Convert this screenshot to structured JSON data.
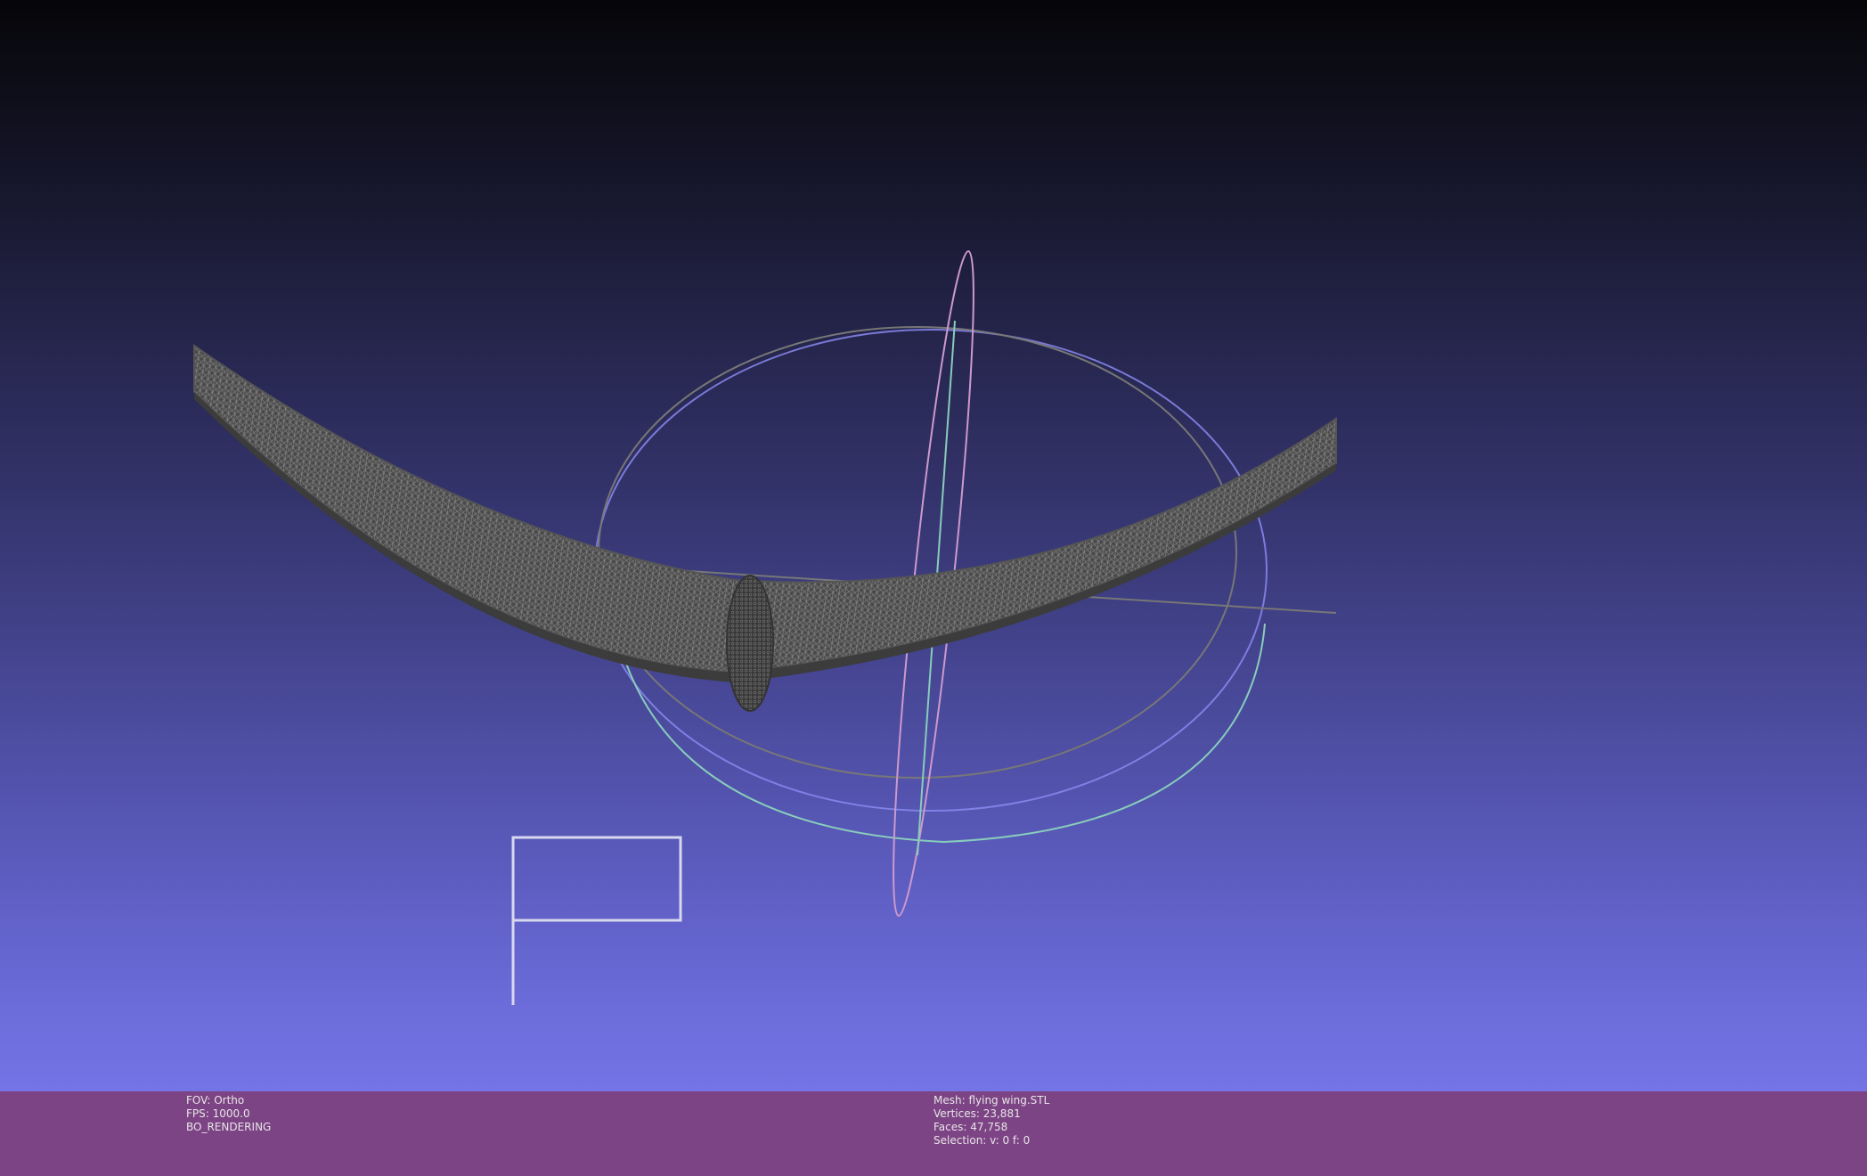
{
  "viewport": {
    "background_top": "#060609",
    "background_bottom": "#7474e6",
    "mesh_color": "#4a4a4a",
    "wireframe_color": "#8a8a8a",
    "trackball_colors": [
      "#8888ee",
      "#88ccbb",
      "#cc99cc",
      "#777777"
    ]
  },
  "info_bar": {
    "background": "#7d4485",
    "left": {
      "fov": "FOV: Ortho",
      "fps": "FPS:  1000.0",
      "mode": "BO_RENDERING"
    },
    "right": {
      "mesh": "Mesh: flying wing.STL",
      "vertices": "Vertices: 23,881",
      "faces": "Faces: 47,758",
      "selection": "Selection: v: 0 f: 0"
    }
  }
}
